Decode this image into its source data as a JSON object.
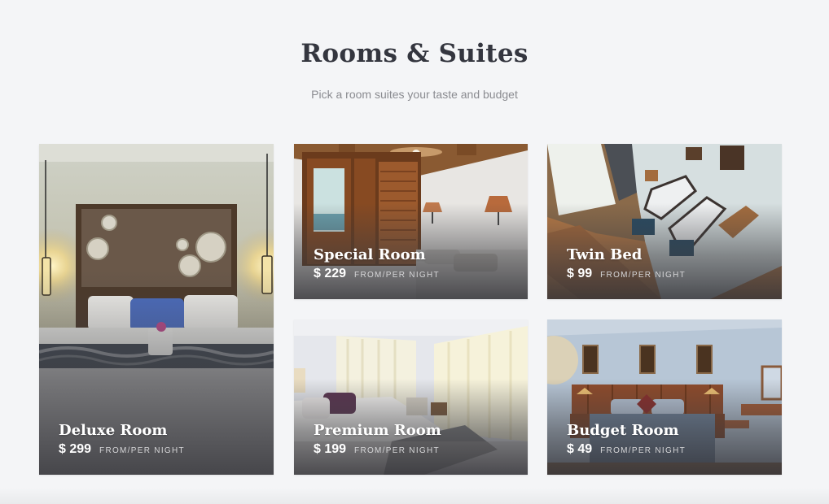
{
  "header": {
    "title": "Rooms & Suites",
    "subtitle": "Pick a room suites your taste and budget"
  },
  "rooms": [
    {
      "name": "Deluxe Room",
      "price": "$ 299",
      "per_label": "FROM/PER NIGHT"
    },
    {
      "name": "Special Room",
      "price": "$ 229",
      "per_label": "FROM/PER NIGHT"
    },
    {
      "name": "Twin Bed",
      "price": "$ 99",
      "per_label": "FROM/PER NIGHT"
    },
    {
      "name": "Premium Room",
      "price": "$ 199",
      "per_label": "FROM/PER NIGHT"
    },
    {
      "name": "Budget Room",
      "price": "$ 49",
      "per_label": "FROM/PER NIGHT"
    }
  ]
}
